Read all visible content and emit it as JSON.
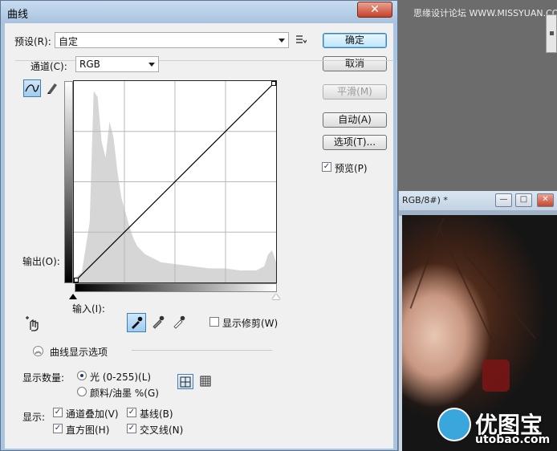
{
  "watermark_top": "思缘设计论坛 WWW.MISSYUAN.COM",
  "photo_window": {
    "title": "RGB/8#) *",
    "buttons": [
      "—",
      "□",
      "✕"
    ]
  },
  "site_logo": {
    "name": "优图宝",
    "url": "utobao.com"
  },
  "dialog": {
    "title": "曲线",
    "close": "✕",
    "preset_label": "预设(R):",
    "preset_value": "自定",
    "channel_label": "通道(C):",
    "channel_value": "RGB",
    "output_label": "输出(O):",
    "input_label": "输入(I):",
    "show_clipping": "显示修剪(W)",
    "curve_display_options": "曲线显示选项",
    "show_amount_label": "显示数量:",
    "amount_light": "光 (0-255)(L)",
    "amount_pigment": "颜料/油墨 %(G)",
    "show_label": "显示:",
    "opt_channel_overlays": "通道叠加(V)",
    "opt_baseline": "基线(B)",
    "opt_histogram": "直方图(H)",
    "opt_intersection": "交叉线(N)",
    "buttons": {
      "ok": "确定",
      "cancel": "取消",
      "smooth": "平滑(M)",
      "auto": "自动(A)",
      "options": "选项(T)...",
      "preview": "预览(P)"
    },
    "state": {
      "preview_checked": true,
      "show_clipping_checked": false,
      "amount_selected": "light",
      "channel_overlays": true,
      "baseline": true,
      "histogram": true,
      "intersection": true,
      "grid_mode": "simple"
    }
  },
  "chart_data": {
    "type": "line",
    "title": "",
    "xlabel": "输入",
    "ylabel": "输出",
    "xlim": [
      0,
      255
    ],
    "ylim": [
      0,
      255
    ],
    "grid": true,
    "curve_points": [
      [
        0,
        0
      ],
      [
        255,
        255
      ]
    ],
    "histogram_approx": [
      [
        0,
        0.02
      ],
      [
        10,
        0.05
      ],
      [
        20,
        0.3
      ],
      [
        25,
        0.95
      ],
      [
        30,
        0.92
      ],
      [
        35,
        0.7
      ],
      [
        40,
        0.62
      ],
      [
        45,
        0.8
      ],
      [
        50,
        0.72
      ],
      [
        55,
        0.55
      ],
      [
        60,
        0.42
      ],
      [
        65,
        0.35
      ],
      [
        70,
        0.28
      ],
      [
        75,
        0.22
      ],
      [
        80,
        0.18
      ],
      [
        90,
        0.14
      ],
      [
        100,
        0.12
      ],
      [
        110,
        0.1
      ],
      [
        130,
        0.09
      ],
      [
        150,
        0.08
      ],
      [
        170,
        0.07
      ],
      [
        190,
        0.07
      ],
      [
        210,
        0.06
      ],
      [
        230,
        0.06
      ],
      [
        240,
        0.08
      ],
      [
        245,
        0.14
      ],
      [
        250,
        0.16
      ],
      [
        255,
        0.1
      ]
    ]
  }
}
